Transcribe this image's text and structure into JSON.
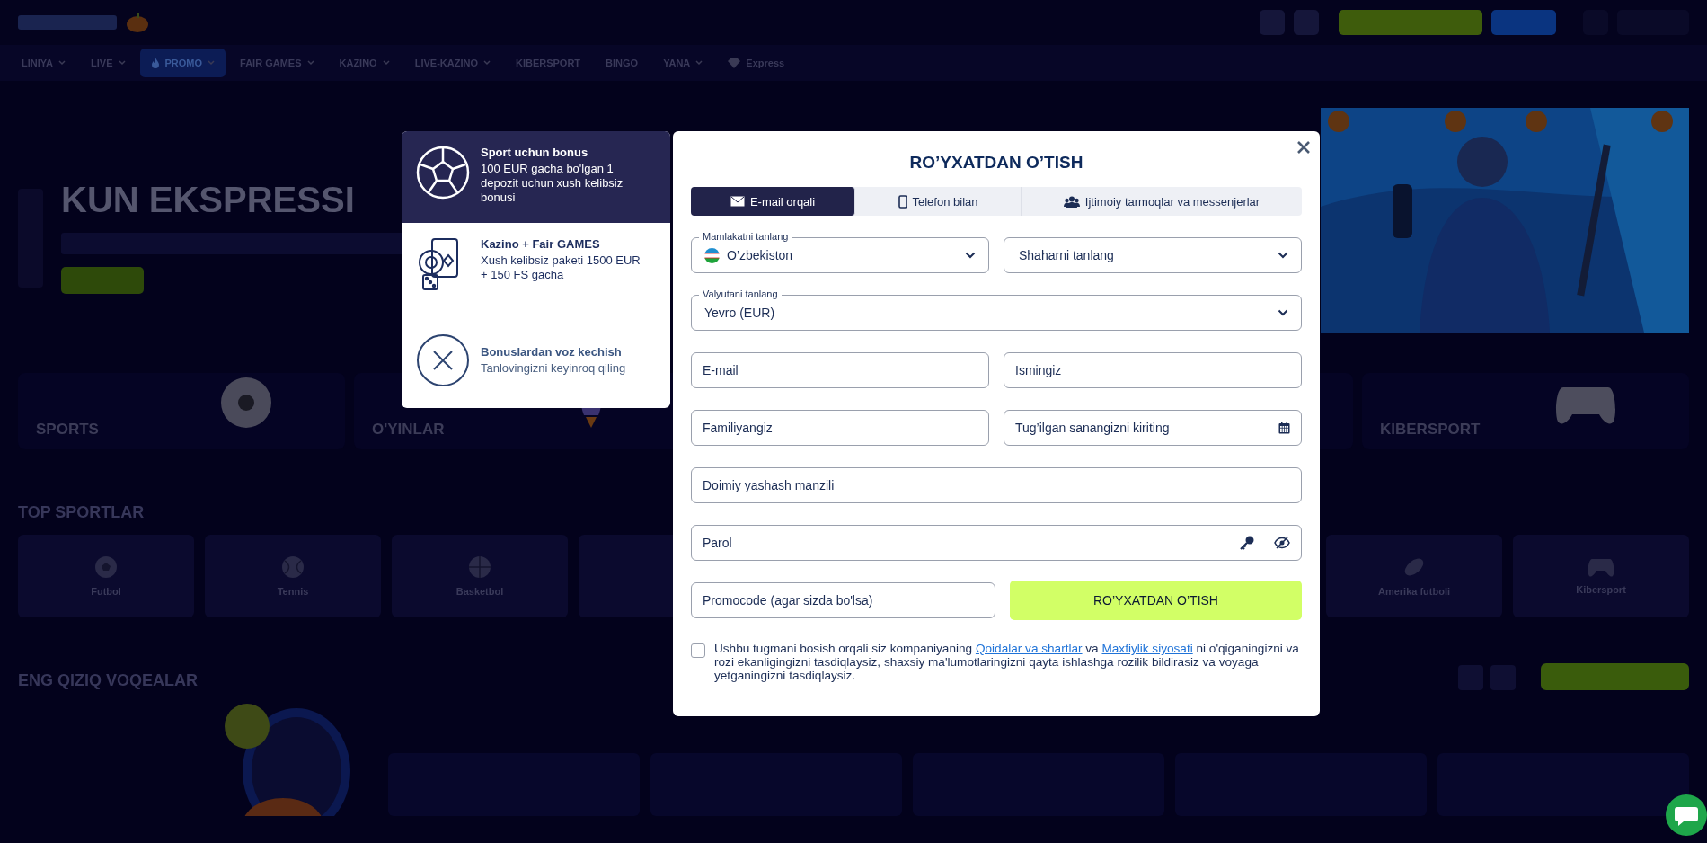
{
  "nav": [
    {
      "label": "LINIYA",
      "kind": "plain",
      "has_menu": true,
      "selected": false
    },
    {
      "label": "LIVE",
      "kind": "plain",
      "has_menu": true,
      "selected": false
    },
    {
      "label": "PROMO",
      "kind": "fire",
      "has_menu": true,
      "selected": true
    },
    {
      "label": "FAIR GAMES",
      "kind": "plain",
      "has_menu": true,
      "selected": false
    },
    {
      "label": "KAZINO",
      "kind": "plain",
      "has_menu": true,
      "selected": false
    },
    {
      "label": "LIVE-KAZINO",
      "kind": "plain",
      "has_menu": true,
      "selected": false
    },
    {
      "label": "KIBERSPORT",
      "kind": "plain",
      "has_menu": false,
      "selected": false
    },
    {
      "label": "BINGO",
      "kind": "plain",
      "has_menu": false,
      "selected": false
    },
    {
      "label": "YANA",
      "kind": "plain",
      "has_menu": true,
      "selected": false
    },
    {
      "label": "Express",
      "kind": "diamond",
      "has_menu": false,
      "selected": false
    }
  ],
  "banner": {
    "title": "KUN EKSPRESSI"
  },
  "categories_start": [
    {
      "label": "SPORTS",
      "kind": "ball"
    },
    {
      "label": "O'YINLAR",
      "kind": "rocket"
    }
  ],
  "categories_end": [
    {
      "label": "KIBERSPORT",
      "kind": "gamepad"
    }
  ],
  "top_sports": {
    "title": "TOP SPORTLAR",
    "tiles_start": [
      {
        "label": "Futbol",
        "kind": "football"
      },
      {
        "label": "Tennis",
        "kind": "tennis"
      },
      {
        "label": "Basketbol",
        "kind": "basketball"
      }
    ],
    "tiles_end": [
      {
        "label": "Amerika futboli",
        "kind": "rugby"
      },
      {
        "label": "Kibersport",
        "kind": "gamepad"
      }
    ]
  },
  "events": {
    "title": "ENG QIZIQ VOQEALAR"
  },
  "bonuses": [
    {
      "kind": "sport",
      "title": "Sport uchun bonus",
      "text": "100 EUR gacha bo'lgan 1 depozit uchun xush kelibsiz bonusi",
      "selected": true
    },
    {
      "kind": "casino",
      "title": "Kazino + Fair GAMES",
      "text": "Xush kelibsiz paketi 1500 EUR + 150 FS gacha",
      "selected": false
    },
    {
      "kind": "decline",
      "title": "Bonuslardan voz kechish",
      "text": "Tanlovingizni keyinroq qiling",
      "selected": false
    }
  ],
  "registration": {
    "title": "RO’YXATDAN O’TISH",
    "tabs": [
      {
        "label": "E-mail orqali",
        "kind": "email",
        "selected": true
      },
      {
        "label": "Telefon bilan",
        "kind": "phone",
        "selected": false
      },
      {
        "label": "Ijtimoiy tarmoqlar va messenjerlar",
        "kind": "social",
        "selected": false
      }
    ],
    "rows": [
      [
        {
          "kind": "select",
          "label": "Mamlakatni tanlang",
          "value": "O’zbekiston",
          "flag": true
        },
        {
          "kind": "select",
          "value": "Shaharni tanlang",
          "flag": false
        }
      ],
      [
        {
          "kind": "select",
          "label": "Valyutani tanlang",
          "value": "Yevro (EUR)",
          "flag": false
        }
      ],
      [
        {
          "kind": "input",
          "placeholder": "E-mail"
        },
        {
          "kind": "input",
          "placeholder": "Ismingiz"
        }
      ],
      [
        {
          "kind": "input",
          "placeholder": "Familiyangiz"
        },
        {
          "kind": "date",
          "placeholder": "Tug’ilgan sanangizni kiriting"
        }
      ],
      [
        {
          "kind": "input",
          "placeholder": "Doimiy yashash manzili"
        }
      ],
      [
        {
          "kind": "password",
          "placeholder": "Parol"
        }
      ],
      [
        {
          "kind": "input",
          "placeholder": "Promocode (agar sizda bo'lsa)"
        },
        {
          "kind": "button",
          "label": "RO’YXATDAN O’TISH"
        }
      ]
    ],
    "consent": {
      "checked": false,
      "before": "Ushbu tugmani bosish orqali siz kompaniyaning",
      "link1": "Qoidalar va shartlar",
      "middle": "va",
      "link2": "Maxfiylik siyosati",
      "after": "ni o'qiganingizni va rozi ekanligingizni tasdiqlaysiz, shaxsiy ma'lumotlaringizni qayta ishlashga rozilik bildirasiz va voyaga yetganingizni tasdiqlaysiz."
    }
  }
}
